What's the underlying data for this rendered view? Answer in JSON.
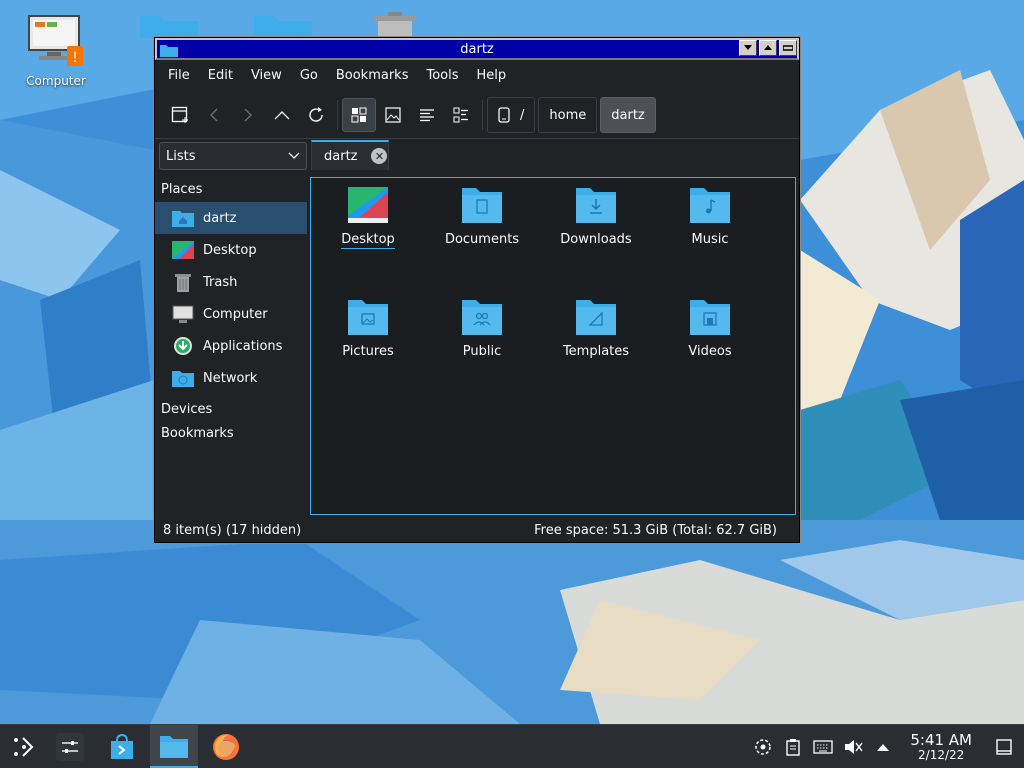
{
  "desktop": {
    "icons": [
      {
        "label": "Computer"
      }
    ]
  },
  "window": {
    "title": "dartz",
    "menu": [
      "File",
      "Edit",
      "View",
      "Go",
      "Bookmarks",
      "Tools",
      "Help"
    ],
    "breadcrumb": {
      "root": "/",
      "items": [
        "home",
        "dartz"
      ]
    },
    "places_view_select": "Lists",
    "places": {
      "title": "Places",
      "items": [
        "dartz",
        "Desktop",
        "Trash",
        "Computer",
        "Applications",
        "Network"
      ],
      "selected": "dartz",
      "groups": [
        "Devices",
        "Bookmarks"
      ]
    },
    "tab": {
      "label": "dartz"
    },
    "files": [
      "Desktop",
      "Documents",
      "Downloads",
      "Music",
      "Pictures",
      "Public",
      "Templates",
      "Videos"
    ],
    "status": {
      "items": "8 item(s) (17 hidden)",
      "space": "Free space: 51.3 GiB (Total: 62.7 GiB)"
    }
  },
  "taskbar": {
    "clock": {
      "time": "5:41 AM",
      "date": "2/12/22"
    }
  },
  "colors": {
    "accent": "#3daee9",
    "window_bg": "#202326",
    "titlebar": "#0000a8",
    "folder": "#3daee9",
    "taskbar": "#2a2e32"
  }
}
